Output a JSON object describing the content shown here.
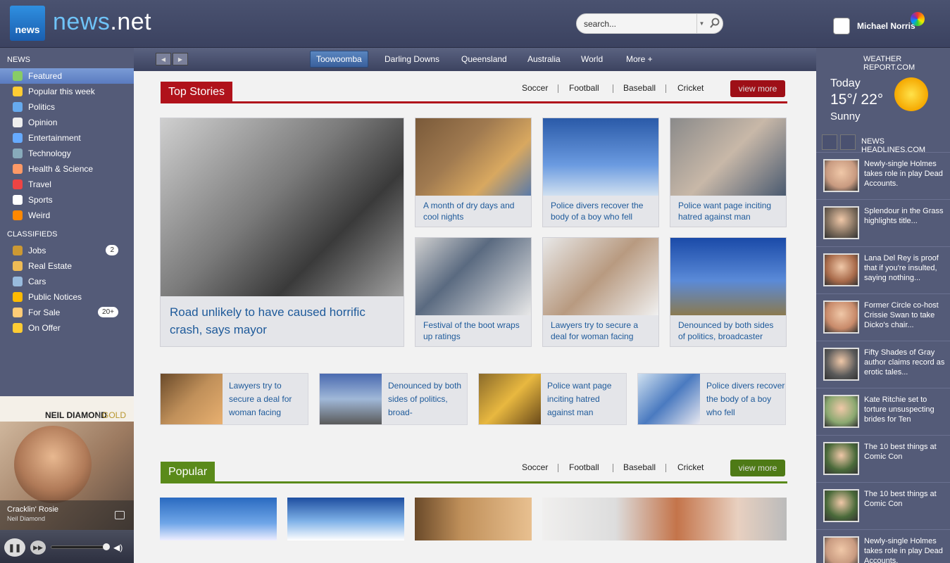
{
  "header": {
    "logo_box": "news",
    "logo_word": "news",
    "logo_tld": ".net",
    "search_placeholder": "search...",
    "user_name": "Michael Norris"
  },
  "sidebar": {
    "news_title": "NEWS",
    "news_items": [
      {
        "label": "Featured",
        "icon": "star-badge-icon"
      },
      {
        "label": "Popular this week",
        "icon": "star-icon"
      },
      {
        "label": "Politics",
        "icon": "globe-icon"
      },
      {
        "label": "Opinion",
        "icon": "speech-icon"
      },
      {
        "label": "Entertainment",
        "icon": "music-note-icon"
      },
      {
        "label": "Technology",
        "icon": "computer-icon"
      },
      {
        "label": "Health & Science",
        "icon": "flask-icon"
      },
      {
        "label": "Travel",
        "icon": "car-icon"
      },
      {
        "label": "Sports",
        "icon": "ball-icon"
      },
      {
        "label": "Weird",
        "icon": "pumpkin-icon"
      }
    ],
    "classifieds_title": "CLASSIFIEDS",
    "classified_items": [
      {
        "label": "Jobs",
        "icon": "briefcase-icon",
        "badge": "2"
      },
      {
        "label": "Real Estate",
        "icon": "house-icon"
      },
      {
        "label": "Cars",
        "icon": "car-icon"
      },
      {
        "label": "Public Notices",
        "icon": "warning-icon"
      },
      {
        "label": "For Sale",
        "icon": "tag-icon",
        "badge": "20+"
      },
      {
        "label": "On Offer",
        "icon": "star-icon"
      }
    ]
  },
  "player": {
    "album_artist": "NEIL DIAMOND",
    "album_label": "GOLD",
    "track_title": "Cracklin' Rosie",
    "track_artist": "Neil Diamond"
  },
  "subnav": {
    "tabs": [
      "Toowoomba",
      "Darling Downs",
      "Queensland",
      "Australia",
      "World",
      "More +"
    ],
    "active_tab": "Toowoomba"
  },
  "top_stories": {
    "title": "Top Stories",
    "categories": [
      "Soccer",
      "Football",
      "Baseball",
      "Cricket"
    ],
    "view_more": "view more",
    "feature_caption": "Road unlikely to have caused horrific crash, says mayor",
    "cards": [
      "A month of dry days and cool nights",
      "Police divers recover the body of a boy who fell",
      "Police want page inciting hatred against man",
      "Festival of the boot wraps up ratings",
      "Lawyers try to secure a deal for woman facing",
      "Denounced by both sides of politics, broadcaster"
    ],
    "strip": [
      "Lawyers try to secure a deal for woman facing",
      "Denounced by both sides of politics, broad-",
      "Police want page inciting hatred against man",
      "Police divers recover the body of a boy who fell"
    ]
  },
  "popular": {
    "title": "Popular",
    "categories": [
      "Soccer",
      "Football",
      "Baseball",
      "Cricket"
    ],
    "view_more": "view more"
  },
  "weather": {
    "title": "WEATHER REPORT.COM",
    "day": "Today",
    "temp": "15°/ 22°",
    "condition": "Sunny"
  },
  "headlines": {
    "title": "NEWS HEADLINES.COM",
    "items": [
      "Newly-single Holmes takes role in play Dead Accounts.",
      "Splendour in the Grass highlights title...",
      "Lana Del Rey is proof that if you're insulted, saying nothing...",
      "Former Circle co-host Crissie Swan to take Dicko's chair...",
      "Fifty Shades of Gray author claims record as erotic tales...",
      "Kate Ritchie set to torture unsuspecting brides for Ten",
      "The 10 best things at Comic Con",
      "The 10 best things at Comic Con",
      "Newly-single Holmes takes role in play Dead Accounts."
    ]
  },
  "colors": {
    "top_stories_accent": "#b0121b",
    "popular_accent": "#5a8a1a",
    "link_blue": "#1e5a9a",
    "sidebar_bg": "#545b78"
  }
}
